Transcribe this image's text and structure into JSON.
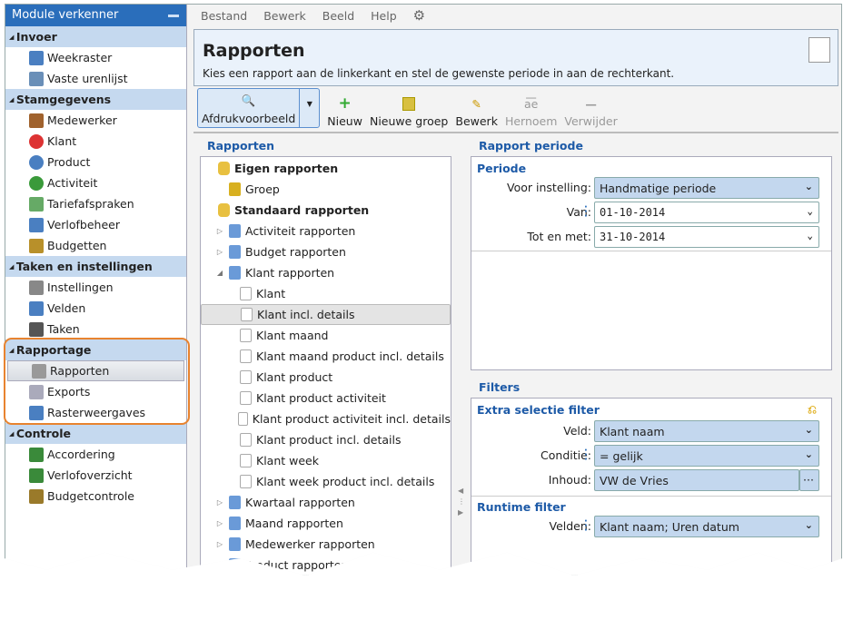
{
  "sidebar": {
    "title": "Module verkenner",
    "sections": [
      {
        "label": "Invoer",
        "items": [
          "Weekraster",
          "Vaste urenlijst"
        ]
      },
      {
        "label": "Stamgegevens",
        "items": [
          "Medewerker",
          "Klant",
          "Product",
          "Activiteit",
          "Tariefafspraken",
          "Verlofbeheer",
          "Budgetten"
        ]
      },
      {
        "label": "Taken en instellingen",
        "items": [
          "Instellingen",
          "Velden",
          "Taken"
        ]
      },
      {
        "label": "Rapportage",
        "items": [
          "Rapporten",
          "Exports",
          "Rasterweergaves"
        ]
      },
      {
        "label": "Controle",
        "items": [
          "Accordering",
          "Verlofoverzicht",
          "Budgetcontrole"
        ]
      }
    ],
    "selected": "Rapporten"
  },
  "menu": [
    "Bestand",
    "Bewerk",
    "Beeld",
    "Help"
  ],
  "header": {
    "title": "Rapporten",
    "subtitle": "Kies een rapport aan de linkerkant en stel de gewenste periode in aan de rechterkant."
  },
  "toolbar": {
    "preview": "Afdrukvoorbeeld",
    "new": "Nieuw",
    "new_group": "Nieuwe groep",
    "edit": "Bewerk",
    "rename": "Hernoem",
    "delete": "Verwijder"
  },
  "tree": {
    "title": "Rapporten",
    "items": [
      {
        "label": "Eigen rapporten",
        "level": 0,
        "bold": true,
        "type": "db"
      },
      {
        "label": "Groep",
        "level": 1,
        "type": "group"
      },
      {
        "label": "Standaard rapporten",
        "level": 0,
        "bold": true,
        "type": "db"
      },
      {
        "label": "Activiteit rapporten",
        "level": 1,
        "type": "folder",
        "exp": "closed"
      },
      {
        "label": "Budget rapporten",
        "level": 1,
        "type": "folder",
        "exp": "closed"
      },
      {
        "label": "Klant rapporten",
        "level": 1,
        "type": "folder",
        "exp": "open"
      },
      {
        "label": "Klant",
        "level": 2,
        "type": "doc"
      },
      {
        "label": "Klant incl. details",
        "level": 2,
        "type": "doc",
        "selected": true
      },
      {
        "label": "Klant maand",
        "level": 2,
        "type": "doc"
      },
      {
        "label": "Klant maand product incl. details",
        "level": 2,
        "type": "doc"
      },
      {
        "label": "Klant product",
        "level": 2,
        "type": "doc"
      },
      {
        "label": "Klant product activiteit",
        "level": 2,
        "type": "doc"
      },
      {
        "label": "Klant product activiteit incl. details",
        "level": 2,
        "type": "doc"
      },
      {
        "label": "Klant product incl. details",
        "level": 2,
        "type": "doc"
      },
      {
        "label": "Klant week",
        "level": 2,
        "type": "doc"
      },
      {
        "label": "Klant week product incl. details",
        "level": 2,
        "type": "doc"
      },
      {
        "label": "Kwartaal rapporten",
        "level": 1,
        "type": "folder",
        "exp": "closed"
      },
      {
        "label": "Maand rapporten",
        "level": 1,
        "type": "folder",
        "exp": "closed"
      },
      {
        "label": "Medewerker rapporten",
        "level": 1,
        "type": "folder",
        "exp": "closed"
      },
      {
        "label": "Product rapporten",
        "level": 1,
        "type": "folder",
        "exp": "closed"
      }
    ]
  },
  "period": {
    "title": "Rapport periode",
    "group": "Periode",
    "preset_label": "Voor instelling:",
    "preset": "Handmatige periode",
    "from_label": "Van:",
    "from": "01-10-2014",
    "to_label": "Tot en met:",
    "to": "31-10-2014"
  },
  "filters": {
    "title": "Filters",
    "extra": "Extra selectie filter",
    "field_label": "Veld:",
    "field": "Klant naam",
    "cond_label": "Conditie:",
    "cond": "= gelijk",
    "content_label": "Inhoud:",
    "content": "VW de Vries",
    "ellipsis": "···",
    "runtime": "Runtime filter",
    "fields_label": "Velden:",
    "fields": "Klant naam; Uren datum"
  },
  "colors": {
    "accent": "#2a6ebb",
    "highlight": "#e8832f",
    "field_bg": "#c3d7ee"
  }
}
